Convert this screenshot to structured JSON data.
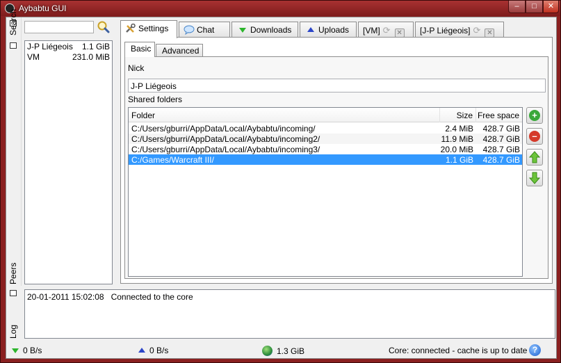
{
  "window": {
    "title": "Aybabtu GUI",
    "minimize": "–",
    "maximize": "□",
    "close": "✕"
  },
  "left_dock": {
    "search_label": "Search",
    "peers_label": "Peers",
    "peers": [
      {
        "name": "J-P Liégeois",
        "size": "1.1 GiB"
      },
      {
        "name": "VM",
        "size": "231.0 MiB"
      }
    ]
  },
  "tabs": {
    "settings": "Settings",
    "chat": "Chat",
    "downloads": "Downloads",
    "uploads": "Uploads",
    "vm": "[VM]",
    "jp": "[J-P Liégeois]"
  },
  "settings": {
    "subtabs": {
      "basic": "Basic",
      "advanced": "Advanced"
    },
    "nick_label": "Nick",
    "nick_value": "J-P Liégeois",
    "shared_label": "Shared folders",
    "columns": {
      "folder": "Folder",
      "size": "Size",
      "free": "Free space"
    },
    "rows": [
      {
        "folder": "C:/Users/gburri/AppData/Local/Aybabtu/incoming/",
        "size": "2.4 MiB",
        "free": "428.7 GiB"
      },
      {
        "folder": "C:/Users/gburri/AppData/Local/Aybabtu/incoming2/",
        "size": "11.9 MiB",
        "free": "428.7 GiB"
      },
      {
        "folder": "C:/Users/gburri/AppData/Local/Aybabtu/incoming3/",
        "size": "20.0 MiB",
        "free": "428.7 GiB"
      },
      {
        "folder": "C:/Games/Warcraft III/",
        "size": "1.1 GiB",
        "free": "428.7 GiB"
      }
    ],
    "selected_row": 3
  },
  "log": {
    "label": "Log",
    "entries": [
      {
        "time": "20-01-2011 15:02:08",
        "message": "Connected to the core"
      }
    ]
  },
  "status": {
    "download_rate": "0 B/s",
    "upload_rate": "0 B/s",
    "shared_total": "1.3 GiB",
    "core_status": "Core: connected - cache is up to date",
    "help": "?"
  },
  "colors": {
    "titlebar": "#8a2020",
    "selection": "#3399ff",
    "add": "#3aa83a",
    "remove": "#d53a2a",
    "arrow": "#4caf2a"
  }
}
